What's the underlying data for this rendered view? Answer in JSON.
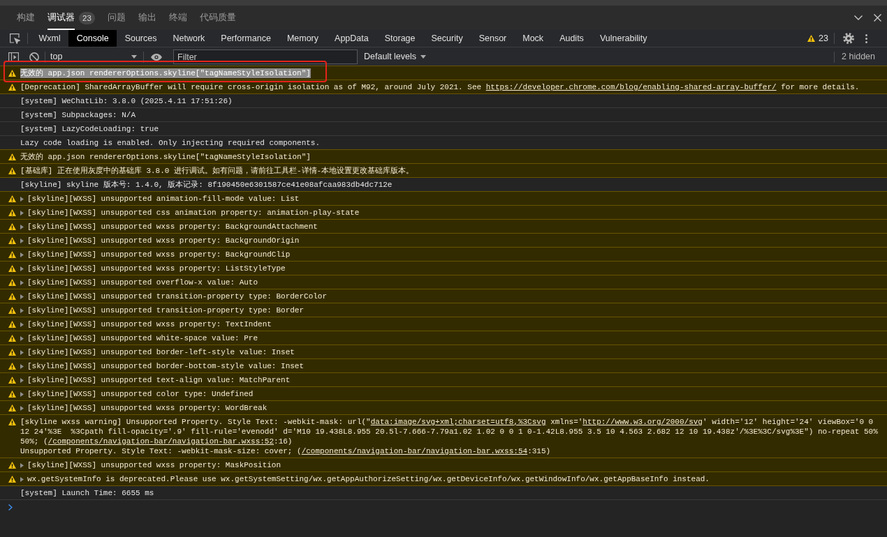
{
  "top_tabs": [
    {
      "label": "构建",
      "selected": false
    },
    {
      "label": "调试器",
      "selected": true,
      "badge": "23"
    },
    {
      "label": "问题",
      "selected": false
    },
    {
      "label": "输出",
      "selected": false
    },
    {
      "label": "终端",
      "selected": false
    },
    {
      "label": "代码质量",
      "selected": false
    }
  ],
  "devtools_tabs": [
    {
      "label": "Wxml",
      "selected": false
    },
    {
      "label": "Console",
      "selected": true
    },
    {
      "label": "Sources",
      "selected": false
    },
    {
      "label": "Network",
      "selected": false
    },
    {
      "label": "Performance",
      "selected": false
    },
    {
      "label": "Memory",
      "selected": false
    },
    {
      "label": "AppData",
      "selected": false
    },
    {
      "label": "Storage",
      "selected": false
    },
    {
      "label": "Security",
      "selected": false
    },
    {
      "label": "Sensor",
      "selected": false
    },
    {
      "label": "Mock",
      "selected": false
    },
    {
      "label": "Audits",
      "selected": false
    },
    {
      "label": "Vulnerability",
      "selected": false
    }
  ],
  "issues": {
    "count": "23"
  },
  "console_toolbar": {
    "context": "top",
    "filter": {
      "placeholder": "Filter"
    },
    "levels": "Default levels",
    "hidden": "2 hidden"
  },
  "messages": [
    {
      "kind": "warning",
      "expandable": false,
      "annotated": true,
      "text_selected": true,
      "text": "无效的 app.json rendererOptions.skyline[\"tagNameStyleIsolation\"]"
    },
    {
      "kind": "warning",
      "expandable": false,
      "annotated": false,
      "text_selected": false,
      "parts": [
        {
          "kind": "text",
          "text": "[Deprecation] SharedArrayBuffer will require cross-origin isolation as of M92, around July 2021. See "
        },
        {
          "kind": "link",
          "text": "https://developer.chrome.com/blog/enabling-shared-array-buffer/"
        },
        {
          "kind": "text",
          "text": " for more details."
        }
      ]
    },
    {
      "kind": "info",
      "expandable": false,
      "annotated": false,
      "text_selected": false,
      "text": "[system] WeChatLib: 3.8.0 (2025.4.11 17:51:26)"
    },
    {
      "kind": "info",
      "expandable": false,
      "annotated": false,
      "text_selected": false,
      "text": "[system] Subpackages: N/A"
    },
    {
      "kind": "info",
      "expandable": false,
      "annotated": false,
      "text_selected": false,
      "text": "[system] LazyCodeLoading: true"
    },
    {
      "kind": "info",
      "expandable": false,
      "annotated": false,
      "text_selected": false,
      "text": "Lazy code loading is enabled. Only injecting required components."
    },
    {
      "kind": "warning",
      "expandable": false,
      "annotated": false,
      "text_selected": false,
      "text": "无效的 app.json rendererOptions.skyline[\"tagNameStyleIsolation\"]"
    },
    {
      "kind": "warning",
      "expandable": false,
      "annotated": false,
      "text_selected": false,
      "text": "[基础库] 正在使用灰度中的基础库 3.8.0 进行调试。如有问题，请前往工具栏-详情-本地设置更改基础库版本。"
    },
    {
      "kind": "info",
      "expandable": false,
      "annotated": false,
      "text_selected": false,
      "text": "[skyline] skyline 版本号: 1.4.0, 版本记录: 8f190450e6301587ce41e08afcaa983db4dc712e"
    },
    {
      "kind": "warning",
      "expandable": true,
      "annotated": false,
      "text_selected": false,
      "text": "[skyline][WXSS] unsupported animation-fill-mode value: List"
    },
    {
      "kind": "warning",
      "expandable": true,
      "annotated": false,
      "text_selected": false,
      "text": "[skyline][WXSS] unsupported css animation property: animation-play-state"
    },
    {
      "kind": "warning",
      "expandable": true,
      "annotated": false,
      "text_selected": false,
      "text": "[skyline][WXSS] unsupported wxss property: BackgroundAttachment"
    },
    {
      "kind": "warning",
      "expandable": true,
      "annotated": false,
      "text_selected": false,
      "text": "[skyline][WXSS] unsupported wxss property: BackgroundOrigin"
    },
    {
      "kind": "warning",
      "expandable": true,
      "annotated": false,
      "text_selected": false,
      "text": "[skyline][WXSS] unsupported wxss property: BackgroundClip"
    },
    {
      "kind": "warning",
      "expandable": true,
      "annotated": false,
      "text_selected": false,
      "text": "[skyline][WXSS] unsupported wxss property: ListStyleType"
    },
    {
      "kind": "warning",
      "expandable": true,
      "annotated": false,
      "text_selected": false,
      "text": "[skyline][WXSS] unsupported overflow-x value: Auto"
    },
    {
      "kind": "warning",
      "expandable": true,
      "annotated": false,
      "text_selected": false,
      "text": "[skyline][WXSS] unsupported transition-property type: BorderColor"
    },
    {
      "kind": "warning",
      "expandable": true,
      "annotated": false,
      "text_selected": false,
      "text": "[skyline][WXSS] unsupported transition-property type: Border"
    },
    {
      "kind": "warning",
      "expandable": true,
      "annotated": false,
      "text_selected": false,
      "text": "[skyline][WXSS] unsupported wxss property: TextIndent"
    },
    {
      "kind": "warning",
      "expandable": true,
      "annotated": false,
      "text_selected": false,
      "text": "[skyline][WXSS] unsupported white-space value: Pre"
    },
    {
      "kind": "warning",
      "expandable": true,
      "annotated": false,
      "text_selected": false,
      "text": "[skyline][WXSS] unsupported border-left-style value: Inset"
    },
    {
      "kind": "warning",
      "expandable": true,
      "annotated": false,
      "text_selected": false,
      "text": "[skyline][WXSS] unsupported border-bottom-style value: Inset"
    },
    {
      "kind": "warning",
      "expandable": true,
      "annotated": false,
      "text_selected": false,
      "text": "[skyline][WXSS] unsupported text-align value: MatchParent"
    },
    {
      "kind": "warning",
      "expandable": true,
      "annotated": false,
      "text_selected": false,
      "text": "[skyline][WXSS] unsupported color type: Undefined"
    },
    {
      "kind": "warning",
      "expandable": true,
      "annotated": false,
      "text_selected": false,
      "text": "[skyline][WXSS] unsupported wxss property: WordBreak"
    },
    {
      "kind": "warning",
      "expandable": false,
      "annotated": false,
      "text_selected": false,
      "parts": [
        {
          "kind": "text",
          "text": "[skyline wxss warning] Unsupported Property. Style Text: -webkit-mask: url(\""
        },
        {
          "kind": "link",
          "text": "data:image/svg+xml;charset=utf8,%3Csvg"
        },
        {
          "kind": "text",
          "text": " xmlns='"
        },
        {
          "kind": "link",
          "text": "http://www.w3.org/2000/svg"
        },
        {
          "kind": "text",
          "text": "' width='12' height='24' viewBox='0 0 12 24'%3E  %3Cpath fill-opacity='.9' fill-rule='evenodd' d='M10 19.438L8.955 20.5l-7.666-7.79a1.02 1.02 0 0 1 0-1.42L8.955 3.5 10 4.563 2.682 12 10 19.438z'/%3E%3C/svg%3E\") no-repeat 50% 50%; ("
        },
        {
          "kind": "link",
          "text": "/components/navigation-bar/navigation-bar.wxss:52"
        },
        {
          "kind": "text",
          "text": ":16)\nUnsupported Property. Style Text: -webkit-mask-size: cover; ("
        },
        {
          "kind": "link",
          "text": "/components/navigation-bar/navigation-bar.wxss:54"
        },
        {
          "kind": "text",
          "text": ":315)"
        }
      ]
    },
    {
      "kind": "warning",
      "expandable": true,
      "annotated": false,
      "text_selected": false,
      "text": "[skyline][WXSS] unsupported wxss property: MaskPosition"
    },
    {
      "kind": "warning",
      "expandable": true,
      "annotated": false,
      "text_selected": false,
      "text": "wx.getSystemInfo is deprecated.Please use wx.getSystemSetting/wx.getAppAuthorizeSetting/wx.getDeviceInfo/wx.getWindowInfo/wx.getAppBaseInfo instead."
    },
    {
      "kind": "info",
      "expandable": false,
      "annotated": false,
      "text_selected": false,
      "text": "[system] Launch Time: 6655 ms"
    }
  ]
}
